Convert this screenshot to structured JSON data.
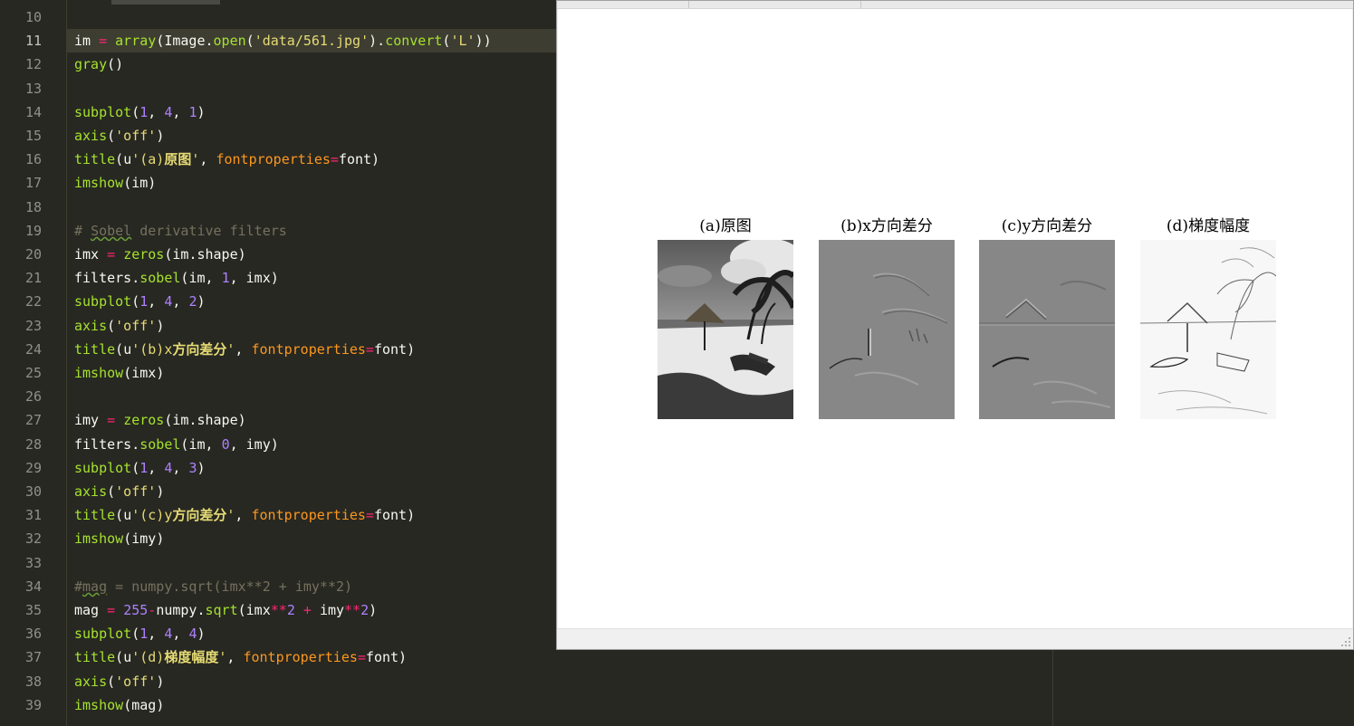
{
  "editor": {
    "active_line": "11",
    "lines": [
      {
        "n": "10",
        "code": ""
      },
      {
        "n": "11",
        "code": "im = array(Image.open('data/561.jpg').convert('L'))"
      },
      {
        "n": "12",
        "code": "gray()"
      },
      {
        "n": "13",
        "code": ""
      },
      {
        "n": "14",
        "code": "subplot(1, 4, 1)"
      },
      {
        "n": "15",
        "code": "axis('off')"
      },
      {
        "n": "16",
        "code": "title(u'(a)原图', fontproperties=font)"
      },
      {
        "n": "17",
        "code": "imshow(im)"
      },
      {
        "n": "18",
        "code": ""
      },
      {
        "n": "19",
        "code": "# Sobel derivative filters"
      },
      {
        "n": "20",
        "code": "imx = zeros(im.shape)"
      },
      {
        "n": "21",
        "code": "filters.sobel(im, 1, imx)"
      },
      {
        "n": "22",
        "code": "subplot(1, 4, 2)"
      },
      {
        "n": "23",
        "code": "axis('off')"
      },
      {
        "n": "24",
        "code": "title(u'(b)x方向差分', fontproperties=font)"
      },
      {
        "n": "25",
        "code": "imshow(imx)"
      },
      {
        "n": "26",
        "code": ""
      },
      {
        "n": "27",
        "code": "imy = zeros(im.shape)"
      },
      {
        "n": "28",
        "code": "filters.sobel(im, 0, imy)"
      },
      {
        "n": "29",
        "code": "subplot(1, 4, 3)"
      },
      {
        "n": "30",
        "code": "axis('off')"
      },
      {
        "n": "31",
        "code": "title(u'(c)y方向差分', fontproperties=font)"
      },
      {
        "n": "32",
        "code": "imshow(imy)"
      },
      {
        "n": "33",
        "code": ""
      },
      {
        "n": "34",
        "code": "#mag = numpy.sqrt(imx**2 + imy**2)"
      },
      {
        "n": "35",
        "code": "mag = 255-numpy.sqrt(imx**2 + imy**2)"
      },
      {
        "n": "36",
        "code": "subplot(1, 4, 4)"
      },
      {
        "n": "37",
        "code": "title(u'(d)梯度幅度', fontproperties=font)"
      },
      {
        "n": "38",
        "code": "axis('off')"
      },
      {
        "n": "39",
        "code": "imshow(mag)"
      }
    ]
  },
  "figure": {
    "subplots": [
      {
        "title": "(a)原图",
        "image": "grayscale beach photo with palm trees and umbrella"
      },
      {
        "title": "(b)x方向差分",
        "image": "horizontal sobel derivative (gray, embossed)"
      },
      {
        "title": "(c)y方向差分",
        "image": "vertical sobel derivative (gray, embossed)"
      },
      {
        "title": "(d)梯度幅度",
        "image": "inverted gradient magnitude (white with dark edges)"
      }
    ]
  },
  "colors": {
    "editor_bg": "#272822",
    "keyword_fn": "#a6e22e",
    "number": "#ae81ff",
    "string": "#e6db74",
    "operator": "#f92672",
    "argument": "#fd971f",
    "comment": "#75715e"
  }
}
